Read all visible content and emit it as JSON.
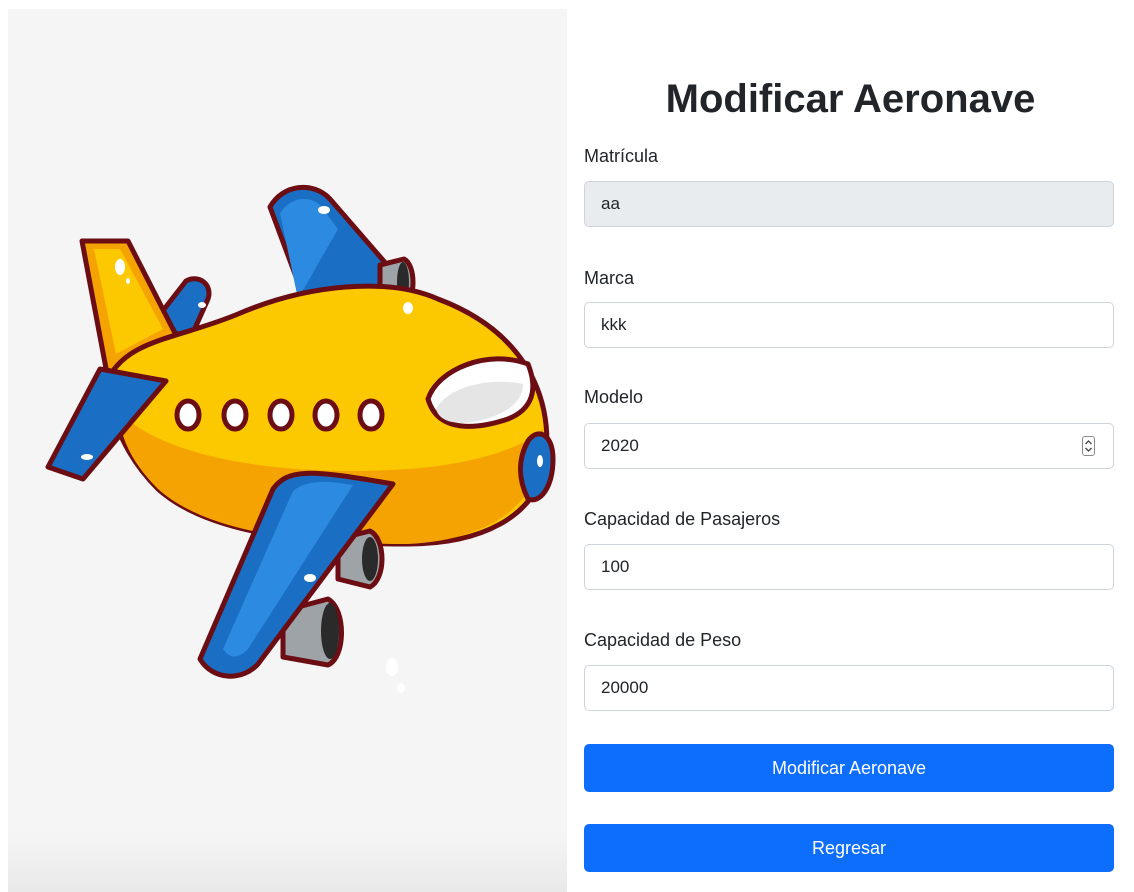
{
  "form": {
    "title": "Modificar Aeronave",
    "fields": [
      {
        "label": "Matrícula",
        "value": "aa",
        "readonly": true
      },
      {
        "label": "Marca",
        "value": "kkk"
      },
      {
        "label": "Modelo",
        "value": "2020",
        "type": "number"
      },
      {
        "label": "Capacidad de Pasajeros",
        "value": "100"
      },
      {
        "label": "Capacidad de Peso",
        "value": "20000"
      }
    ],
    "submit_label": "Modificar Aeronave",
    "back_label": "Regresar"
  },
  "colors": {
    "primary": "#0d6efd",
    "readonly_bg": "#e9ecef",
    "plane_body": "#fcc800",
    "plane_wing": "#1a6fc4",
    "outline": "#6b0d12"
  },
  "icons": {
    "illustration": "airplane-illustration",
    "spinner": "number-spinner-icon"
  }
}
